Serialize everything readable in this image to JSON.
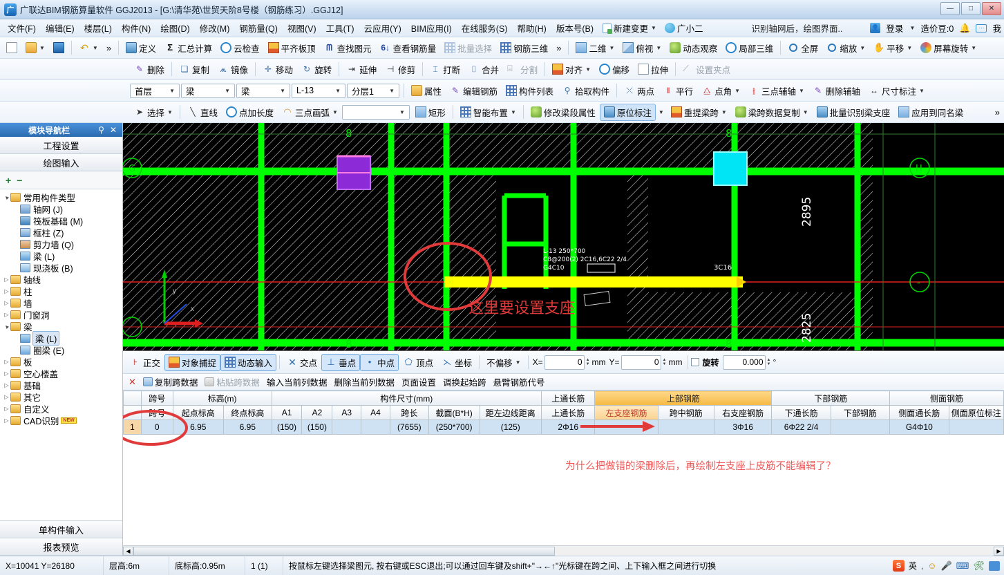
{
  "window": {
    "title": "广联达BIM钢筋算量软件 GGJ2013 - [G:\\清华苑\\世贸天阶8号楼（钢筋练习）.GGJ12]",
    "app_icon": "app-icon",
    "minimize": "—",
    "maximize": "□",
    "close": "✕"
  },
  "menubar": {
    "items": [
      "文件(F)",
      "编辑(E)",
      "楼层(L)",
      "构件(N)",
      "绘图(D)",
      "修改(M)",
      "钢筋量(Q)",
      "视图(V)",
      "工具(T)",
      "云应用(Y)",
      "BIM应用(I)",
      "在线服务(S)",
      "帮助(H)",
      "版本号(B)"
    ],
    "new_change": "新建变更",
    "assistant": "广小二",
    "tip": "识别轴网后，绘图界面..",
    "login": "登录",
    "beans": "造价豆:0",
    "me": "我"
  },
  "toolbar1": {
    "items": [
      {
        "label": "",
        "icon": "new-doc-icon"
      },
      {
        "label": "",
        "icon": "open-folder-icon",
        "dropdown": true
      },
      {
        "label": "",
        "icon": "save-icon"
      },
      {
        "label": "",
        "icon": "undo-icon",
        "dropdown": true
      },
      {
        "label": "定义",
        "icon": "define-icon"
      },
      {
        "label": "汇总计算",
        "icon": "sigma-icon"
      },
      {
        "label": "云检查",
        "icon": "cloud-check-icon"
      },
      {
        "label": "平齐板顶",
        "icon": "align-slab-icon"
      },
      {
        "label": "查找图元",
        "icon": "binoculars-icon"
      },
      {
        "label": "查看钢筋量",
        "icon": "view-rebar-icon"
      },
      {
        "label": "批量选择",
        "icon": "batch-select-icon",
        "disabled": true
      },
      {
        "label": "钢筋三维",
        "icon": "rebar-3d-icon"
      },
      {
        "label": "二维",
        "icon": "2d-icon",
        "dropdown": true
      },
      {
        "label": "俯视",
        "icon": "top-view-icon",
        "dropdown": true
      },
      {
        "label": "动态观察",
        "icon": "orbit-icon"
      },
      {
        "label": "局部三维",
        "icon": "local-3d-icon"
      },
      {
        "label": "全屏",
        "icon": "fullscreen-icon"
      },
      {
        "label": "缩放",
        "icon": "zoom-icon",
        "dropdown": true
      },
      {
        "label": "平移",
        "icon": "pan-icon",
        "dropdown": true
      },
      {
        "label": "屏幕旋转",
        "icon": "screen-rotate-icon",
        "dropdown": true
      }
    ]
  },
  "toolbar2": {
    "items": [
      {
        "label": "删除",
        "icon": "delete-icon"
      },
      {
        "label": "复制",
        "icon": "copy-icon"
      },
      {
        "label": "镜像",
        "icon": "mirror-icon"
      },
      {
        "label": "移动",
        "icon": "move-icon"
      },
      {
        "label": "旋转",
        "icon": "rotate-icon"
      },
      {
        "label": "延伸",
        "icon": "extend-icon"
      },
      {
        "label": "修剪",
        "icon": "trim-icon"
      },
      {
        "label": "打断",
        "icon": "break-icon"
      },
      {
        "label": "合并",
        "icon": "merge-icon"
      },
      {
        "label": "分割",
        "icon": "split-icon",
        "disabled": true
      },
      {
        "label": "对齐",
        "icon": "align-icon",
        "dropdown": true
      },
      {
        "label": "偏移",
        "icon": "offset-icon"
      },
      {
        "label": "拉伸",
        "icon": "stretch-icon"
      },
      {
        "label": "设置夹点",
        "icon": "grip-icon",
        "disabled": true
      }
    ]
  },
  "toolbar3": {
    "combos": [
      {
        "name": "floor",
        "value": "首层"
      },
      {
        "name": "category",
        "value": "梁"
      },
      {
        "name": "type",
        "value": "梁"
      },
      {
        "name": "member",
        "value": "L-13"
      },
      {
        "name": "layer",
        "value": "分层1"
      }
    ],
    "items": [
      {
        "label": "属性",
        "icon": "properties-icon"
      },
      {
        "label": "编辑钢筋",
        "icon": "edit-rebar-icon"
      },
      {
        "label": "构件列表",
        "icon": "member-list-icon"
      },
      {
        "label": "拾取构件",
        "icon": "pick-member-icon"
      },
      {
        "label": "两点",
        "icon": "two-point-icon"
      },
      {
        "label": "平行",
        "icon": "parallel-icon"
      },
      {
        "label": "点角",
        "icon": "point-angle-icon",
        "dropdown": true
      },
      {
        "label": "三点辅轴",
        "icon": "three-point-axis-icon",
        "dropdown": true
      },
      {
        "label": "删除辅轴",
        "icon": "delete-axis-icon"
      },
      {
        "label": "尺寸标注",
        "icon": "dimension-icon",
        "dropdown": true
      }
    ]
  },
  "toolbar4": {
    "items": [
      {
        "label": "选择",
        "icon": "cursor-icon",
        "dropdown": true
      },
      {
        "label": "直线",
        "icon": "line-icon"
      },
      {
        "label": "点加长度",
        "icon": "point-length-icon"
      },
      {
        "label": "三点画弧",
        "icon": "three-point-arc-icon",
        "dropdown": true
      },
      {
        "label": "矩形",
        "icon": "rectangle-icon"
      },
      {
        "label": "智能布置",
        "icon": "smart-layout-icon",
        "dropdown": true
      },
      {
        "label": "修改梁段属性",
        "icon": "edit-beam-seg-icon"
      },
      {
        "label": "原位标注",
        "icon": "in-situ-label-icon",
        "selected": true,
        "dropdown": true
      },
      {
        "label": "重提梁跨",
        "icon": "re-span-icon",
        "dropdown": true
      },
      {
        "label": "梁跨数据复制",
        "icon": "span-copy-icon",
        "dropdown": true
      },
      {
        "label": "批量识别梁支座",
        "icon": "batch-support-icon"
      },
      {
        "label": "应用到同名梁",
        "icon": "apply-same-beam-icon"
      }
    ],
    "blank_combo": ""
  },
  "sidebar": {
    "title": "模块导航栏",
    "pin": "⚲",
    "close": "✕",
    "buttons": [
      "工程设置",
      "绘图输入"
    ],
    "tools": {
      "add": "+",
      "remove": "−"
    },
    "tree": [
      {
        "label": "常用构件类型",
        "level": 0,
        "kind": "folder",
        "expanded": true
      },
      {
        "label": "轴网 (J)",
        "level": 1,
        "kind": "axis-net-icon"
      },
      {
        "label": "筏板基础 (M)",
        "level": 1,
        "kind": "raft-foundation-icon"
      },
      {
        "label": "框柱 (Z)",
        "level": 1,
        "kind": "frame-column-icon"
      },
      {
        "label": "剪力墙 (Q)",
        "level": 1,
        "kind": "shear-wall-icon"
      },
      {
        "label": "梁 (L)",
        "level": 1,
        "kind": "beam-icon"
      },
      {
        "label": "现浇板 (B)",
        "level": 1,
        "kind": "cast-slab-icon"
      },
      {
        "label": "轴线",
        "level": 0,
        "kind": "folder",
        "expanded": false
      },
      {
        "label": "柱",
        "level": 0,
        "kind": "folder",
        "expanded": false
      },
      {
        "label": "墙",
        "level": 0,
        "kind": "folder",
        "expanded": false
      },
      {
        "label": "门窗洞",
        "level": 0,
        "kind": "folder",
        "expanded": false
      },
      {
        "label": "梁",
        "level": 0,
        "kind": "folder",
        "expanded": true
      },
      {
        "label": "梁 (L)",
        "level": 1,
        "kind": "beam-icon",
        "selected": true
      },
      {
        "label": "圈梁 (E)",
        "level": 1,
        "kind": "ring-beam-icon"
      },
      {
        "label": "板",
        "level": 0,
        "kind": "folder",
        "expanded": false
      },
      {
        "label": "空心楼盖",
        "level": 0,
        "kind": "folder",
        "expanded": false
      },
      {
        "label": "基础",
        "level": 0,
        "kind": "folder",
        "expanded": false
      },
      {
        "label": "其它",
        "level": 0,
        "kind": "folder",
        "expanded": false
      },
      {
        "label": "自定义",
        "level": 0,
        "kind": "folder",
        "expanded": false
      },
      {
        "label": "CAD识别",
        "level": 0,
        "kind": "folder",
        "expanded": false,
        "badge": "NEW"
      }
    ],
    "footer": [
      "单构件输入",
      "报表预览"
    ]
  },
  "canvas": {
    "axis_labels": [
      "8",
      "8",
      "8",
      "8"
    ],
    "circle_labels": [
      "G",
      "H",
      "-"
    ],
    "dim_texts": [
      "2895",
      "2825"
    ],
    "beam_texts": [
      "L-13 250*700",
      "C8@200(2) 2C16,6C22 2/4",
      "G4C10"
    ],
    "rebar_label": "3C16",
    "annotation": "这里要设置支座"
  },
  "snapbar": {
    "toggles": [
      {
        "label": "正交",
        "icon": "ortho-icon",
        "on": false
      },
      {
        "label": "对象捕捉",
        "icon": "object-snap-icon",
        "on": true
      },
      {
        "label": "动态输入",
        "icon": "dynamic-input-icon",
        "on": true
      },
      {
        "label": "交点",
        "icon": "intersection-icon",
        "on": false
      },
      {
        "label": "垂点",
        "icon": "perpendicular-icon",
        "on": true
      },
      {
        "label": "中点",
        "icon": "midpoint-icon",
        "on": true
      },
      {
        "label": "顶点",
        "icon": "vertex-icon",
        "on": false
      },
      {
        "label": "坐标",
        "icon": "coordinate-icon",
        "on": false
      }
    ],
    "offset_mode": "不偏移",
    "x_label": "X=",
    "x_value": "0",
    "x_unit": "mm",
    "y_label": "Y=",
    "y_value": "0",
    "y_unit": "mm",
    "rotate_label": "旋转",
    "rotate_value": "0.000",
    "rotate_unit": "°"
  },
  "gridtools": {
    "items": [
      {
        "label": "复制跨数据",
        "icon": "copy-span-icon",
        "disabled": false
      },
      {
        "label": "粘贴跨数据",
        "icon": "paste-span-icon",
        "disabled": true
      },
      {
        "label": "输入当前列数据",
        "icon": "",
        "disabled": false
      },
      {
        "label": "删除当前列数据",
        "icon": "",
        "disabled": false
      },
      {
        "label": "页面设置",
        "icon": "",
        "disabled": false
      },
      {
        "label": "调换起始跨",
        "icon": "",
        "disabled": false
      },
      {
        "label": "悬臂钢筋代号",
        "icon": "",
        "disabled": false
      }
    ]
  },
  "table": {
    "group_headers": [
      {
        "label": "",
        "span": 1
      },
      {
        "label": "跨号",
        "span": 1
      },
      {
        "label": "标高(m)",
        "span": 2
      },
      {
        "label": "构件尺寸(mm)",
        "span": 7
      },
      {
        "label": "上通长筋",
        "span": 1
      },
      {
        "label": "上部钢筋",
        "span": 3,
        "highlight": true
      },
      {
        "label": "下部钢筋",
        "span": 2
      },
      {
        "label": "侧面钢筋",
        "span": 2
      }
    ],
    "columns": [
      "",
      "跨号",
      "起点标高",
      "终点标高",
      "A1",
      "A2",
      "A3",
      "A4",
      "跨长",
      "截面(B*H)",
      "距左边线距离",
      "上通长筋",
      "左支座钢筋",
      "跨中钢筋",
      "右支座钢筋",
      "下通长筋",
      "下部钢筋",
      "侧面通长筋",
      "侧面原位标注"
    ],
    "rows": [
      {
        "num": "1",
        "values": [
          "0",
          "6.95",
          "6.95",
          "(150)",
          "(150)",
          "",
          "",
          "(7655)",
          "(250*700)",
          "(125)",
          "2Φ16",
          "",
          "",
          "3Φ16",
          "6Φ22 2/4",
          "",
          "G4Φ10",
          ""
        ]
      }
    ],
    "annotation": "为什么把做错的梁删除后，再绘制左支座上皮筋不能编辑了？"
  },
  "statusbar": {
    "coords": "X=10041  Y=26180",
    "floor_height": "层高:6m",
    "base_elev": "底标高:0.95m",
    "page": "1 (1)",
    "hint": "按鼠标左键选择梁图元, 按右键或ESC退出;可以通过回车键及shift+\"→←↑\"光标键在跨之间、上下输入框之间进行切换",
    "ime": "英",
    "tray_icons": [
      "sogou-icon",
      "ime-icon",
      "emoji-icon",
      "mic-icon",
      "keyboard-icon",
      "tool-icon",
      "arrow-icon"
    ]
  },
  "colors": {
    "accent": "#2b6cb0",
    "highlight_header": "#f5b942",
    "red_note": "#e03a3a",
    "cell_select": "#cfe2f3",
    "green_beam": "#00ff00",
    "yellow_beam": "#ffff00"
  }
}
